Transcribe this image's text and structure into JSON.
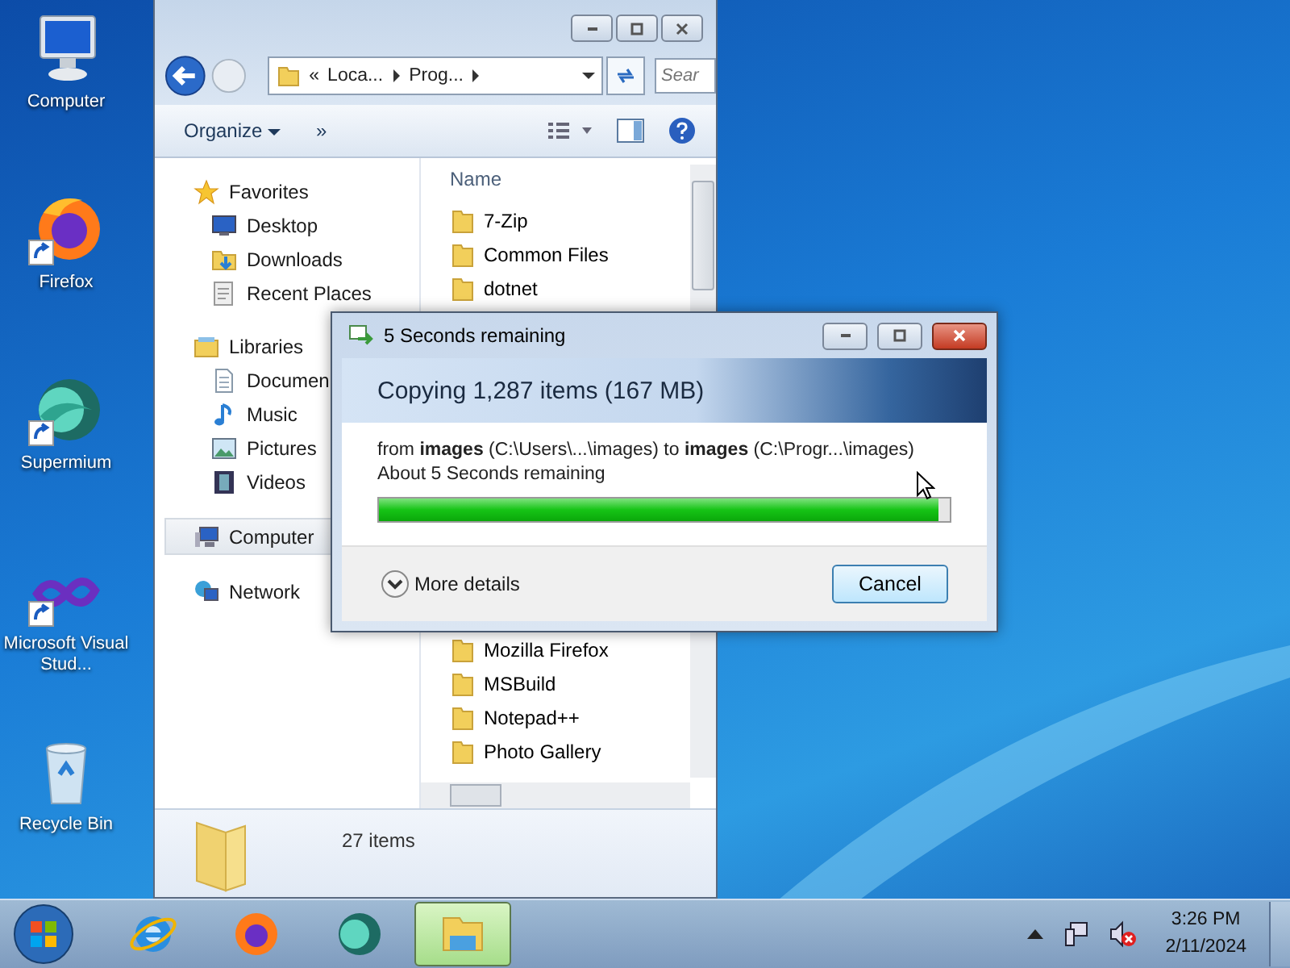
{
  "desktop_icons": [
    {
      "label": "Computer",
      "kind": "computer",
      "shortcut": false
    },
    {
      "label": "Firefox",
      "kind": "firefox",
      "shortcut": true
    },
    {
      "label": "Supermium",
      "kind": "supermium",
      "shortcut": true
    },
    {
      "label": "Microsoft Visual Stud...",
      "kind": "visualstudio",
      "shortcut": true
    },
    {
      "label": "Recycle Bin",
      "kind": "recycle",
      "shortcut": false
    }
  ],
  "explorer": {
    "address": [
      "«",
      "Loca...",
      "Prog..."
    ],
    "search": {
      "placeholder": "Sear"
    },
    "toolbar": [
      "Organize",
      "»"
    ],
    "nav": [
      {
        "label": "Favorites",
        "kind": "star",
        "selected": false,
        "children": [
          {
            "label": "Desktop",
            "kind": "desktop",
            "selected": false
          },
          {
            "label": "Downloads",
            "kind": "downloads",
            "selected": false
          },
          {
            "label": "Recent Places",
            "kind": "recent",
            "selected": false
          }
        ]
      },
      {
        "label": "Libraries",
        "kind": "library",
        "selected": false,
        "children": [
          {
            "label": "Documen",
            "kind": "document",
            "selected": false
          },
          {
            "label": "Music",
            "kind": "music",
            "selected": false
          },
          {
            "label": "Pictures",
            "kind": "picture",
            "selected": false
          },
          {
            "label": "Videos",
            "kind": "video",
            "selected": false
          }
        ]
      },
      {
        "label": "Computer",
        "kind": "computer",
        "selected": true
      },
      {
        "label": "Network",
        "kind": "network",
        "selected": false
      }
    ],
    "column": "Name",
    "files_top": [
      "7-Zip",
      "Common Files",
      "dotnet"
    ],
    "files_bottom": [
      "Mozilla Firefox",
      "MSBuild",
      "Notepad++",
      "Photo Gallery"
    ],
    "status": "27 items"
  },
  "dialog": {
    "title": "5 Seconds remaining",
    "heading": "Copying 1,287 items (167 MB)",
    "from_line": "from **images** (C:\\Users\\...\\images)  to **images** (C:\\Progr...\\images)",
    "time_left": "About 5 Seconds remaining",
    "level": 0.98,
    "details": "More details",
    "cancel": "Cancel"
  },
  "taskbar": {
    "apps": [
      {
        "kind": "ie",
        "selected": false
      },
      {
        "kind": "firefox",
        "selected": false
      },
      {
        "kind": "supermium",
        "selected": false
      },
      {
        "kind": "explorer",
        "selected": true
      }
    ],
    "time": "3:26 PM",
    "date": "2/11/2024"
  }
}
